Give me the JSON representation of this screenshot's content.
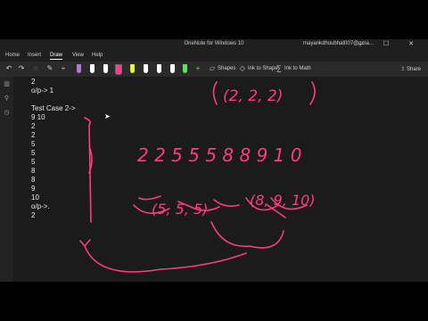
{
  "window": {
    "title": "OneNote for Windows 10",
    "user": "mayankdhoubhat007@gma...",
    "controls": [
      "—",
      "☐",
      "✕"
    ]
  },
  "ribbon": {
    "tabs": [
      "Home",
      "Insert",
      "Draw",
      "View",
      "Help"
    ],
    "active_tab": "Draw"
  },
  "toolbar": {
    "shapes_label": "Shapes",
    "ink_to_shape_label": "Ink to Shape",
    "ink_to_math_label": "Ink to Math",
    "share_label": "Share",
    "pen_colors": [
      "#b07bd6",
      "#ffffff",
      "#ffffff",
      "#ff3c8c",
      "#e7f542",
      "#ffffff",
      "#ffffff",
      "#ffffff",
      "#5fe05f"
    ],
    "accent": "#0078d7"
  },
  "note": {
    "lines": [
      "2",
      "o/p-> 1",
      "",
      "Test Case 2->",
      "9 10",
      "2",
      "2",
      "5",
      "5",
      "5",
      "8",
      "8",
      "9",
      "10",
      "o/p->.",
      "2"
    ]
  },
  "ink": {
    "color": "#ff3c7a",
    "top_text": "(2, 2, 2)",
    "sequence_text": "2 2 5 5 5 8 8 9 1 0",
    "group_left": "(5, 5, 5)",
    "group_right": "(8, 9, 10)"
  }
}
